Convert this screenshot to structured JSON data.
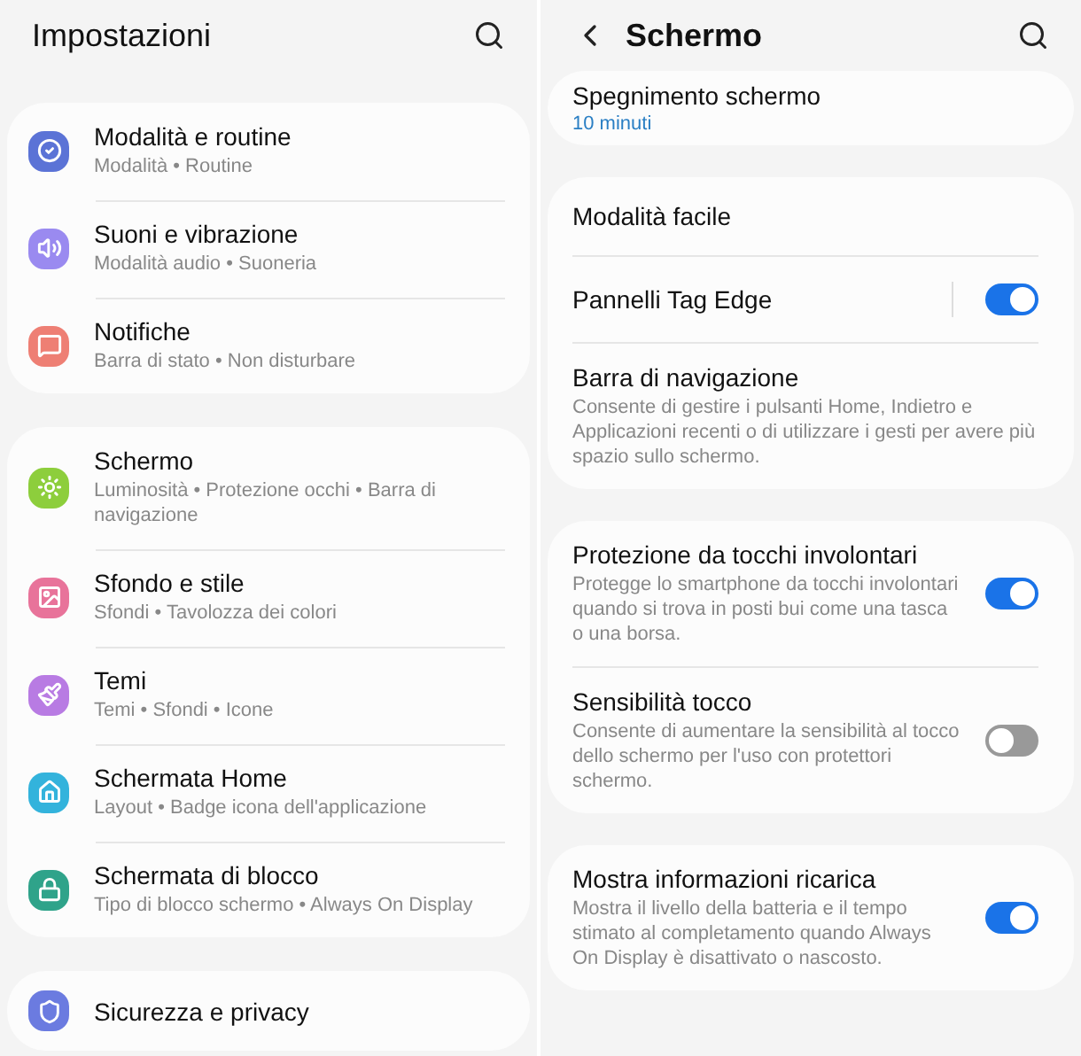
{
  "settings_screen": {
    "title": "Impostazioni",
    "groups": [
      {
        "items": [
          {
            "color": "#5b73d6",
            "title": "Modalità e routine",
            "subtitle": "Modalità • Routine"
          },
          {
            "color": "#9a8af0",
            "title": "Suoni e vibrazione",
            "subtitle": "Modalità audio • Suoneria"
          },
          {
            "color": "#ee7f74",
            "title": "Notifiche",
            "subtitle": "Barra di stato • Non disturbare"
          }
        ]
      },
      {
        "items": [
          {
            "color": "#8dce3c",
            "title": "Schermo",
            "subtitle": "Luminosità • Protezione occhi • Barra di navigazione"
          },
          {
            "color": "#e8739a",
            "title": "Sfondo e stile",
            "subtitle": "Sfondi • Tavolozza dei colori"
          },
          {
            "color": "#b87be3",
            "title": "Temi",
            "subtitle": "Temi • Sfondi • Icone"
          },
          {
            "color": "#33b3dc",
            "title": "Schermata Home",
            "subtitle": "Layout • Badge icona dell'applicazione"
          },
          {
            "color": "#2fa38a",
            "title": "Schermata di blocco",
            "subtitle": "Tipo di blocco schermo • Always On Display"
          }
        ]
      },
      {
        "items": [
          {
            "color": "#6b7be0",
            "title": "Sicurezza e privacy"
          }
        ]
      }
    ]
  },
  "display_screen": {
    "title": "Schermo",
    "groups": [
      {
        "items": [
          {
            "kind": "value",
            "title": "Spegnimento schermo",
            "value": "10 minuti"
          }
        ]
      },
      {
        "items": [
          {
            "kind": "plain",
            "title": "Modalità facile"
          },
          {
            "kind": "toggle",
            "title": "Pannelli Tag Edge",
            "on": true
          },
          {
            "kind": "plain",
            "title": "Barra di navigazione",
            "description": "Consente di gestire i pulsanti Home, Indietro e Applicazioni recenti o di utilizzare i gesti per avere più spazio sullo schermo."
          }
        ]
      },
      {
        "items": [
          {
            "kind": "toggle",
            "title": "Protezione da tocchi involontari",
            "description": "Protegge lo smartphone da tocchi involontari quando si trova in posti bui come una tasca o una borsa.",
            "on": true
          },
          {
            "kind": "toggle",
            "title": "Sensibilità tocco",
            "description": "Consente di aumentare la sensibilità al tocco dello schermo per l'uso con protettori schermo.",
            "on": false
          }
        ]
      },
      {
        "items": [
          {
            "kind": "toggle",
            "title": "Mostra informazioni ricarica",
            "description": "Mostra il livello della batteria e il tempo stimato al completamento quando Always On Display è disattivato o nascosto.",
            "on": true
          }
        ]
      }
    ]
  }
}
